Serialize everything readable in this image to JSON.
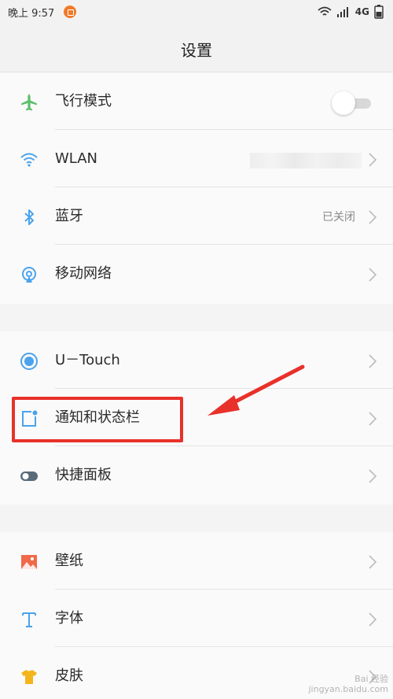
{
  "status_bar": {
    "time": "晚上 9:57",
    "network": "4G"
  },
  "header": {
    "title": "设置"
  },
  "groups": [
    {
      "items": [
        {
          "label": "飞行模式",
          "icon": "airplane-icon",
          "control": "toggle",
          "toggle_on": false
        },
        {
          "label": "WLAN",
          "icon": "wifi-icon",
          "value_obscured": true
        },
        {
          "label": "蓝牙",
          "icon": "bluetooth-icon",
          "value": "已关闭"
        },
        {
          "label": "移动网络",
          "icon": "mobile-network-icon"
        }
      ]
    },
    {
      "items": [
        {
          "label": "U－Touch",
          "icon": "utouch-icon"
        },
        {
          "label": "通知和状态栏",
          "icon": "notification-icon"
        },
        {
          "label": "快捷面板",
          "icon": "quick-panel-icon"
        }
      ]
    },
    {
      "items": [
        {
          "label": "壁纸",
          "icon": "wallpaper-icon"
        },
        {
          "label": "字体",
          "icon": "font-icon"
        },
        {
          "label": "皮肤",
          "icon": "skin-icon"
        }
      ]
    }
  ],
  "colors": {
    "accent_blue": "#4aa3ec",
    "airplane_green": "#5cbf6a",
    "wallpaper_orange": "#f06a4a",
    "skin_yellow": "#f3b51b",
    "annotation_red": "#e8312a"
  },
  "watermark": {
    "line1": "Bai 经验",
    "line2": "jingyan.baidu.com"
  }
}
